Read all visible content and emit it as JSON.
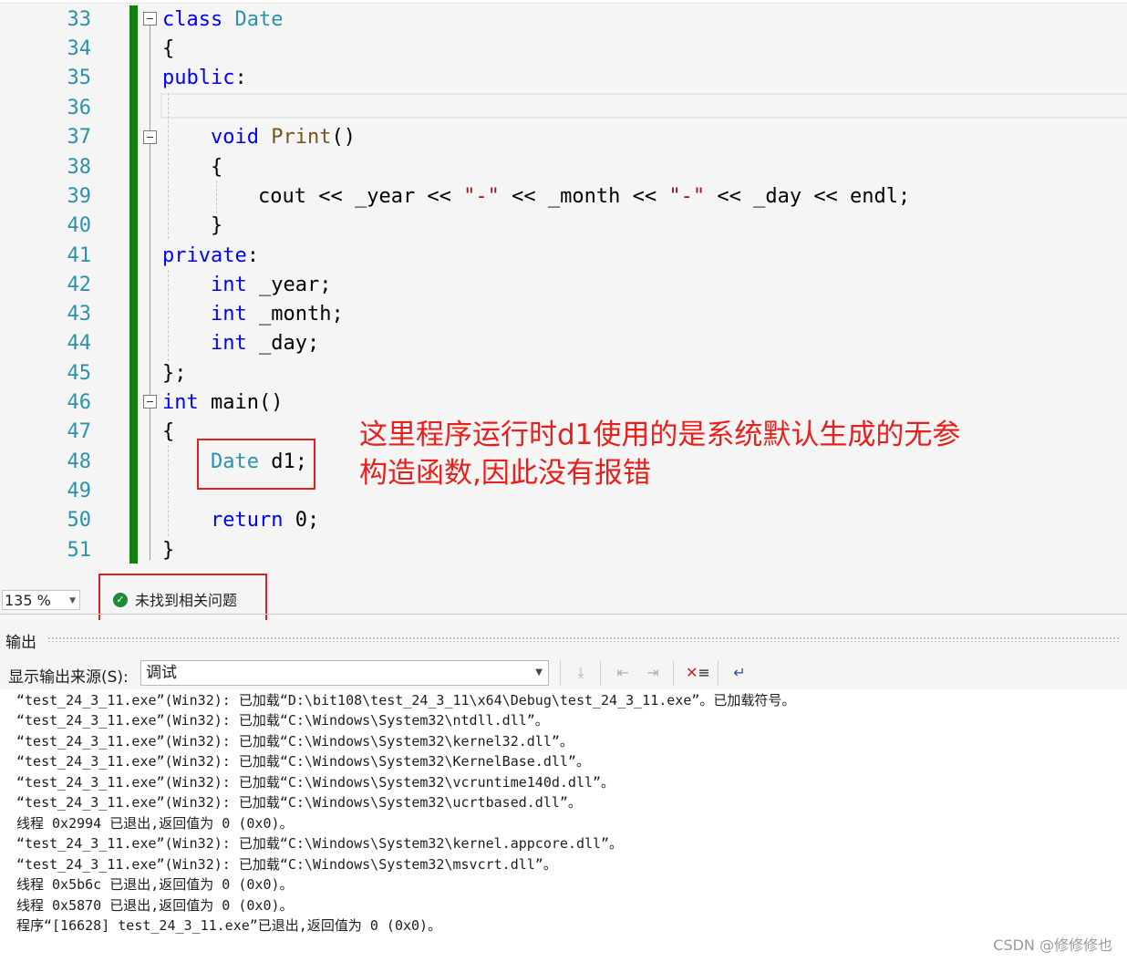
{
  "editor": {
    "line_numbers": [
      "33",
      "34",
      "35",
      "36",
      "37",
      "38",
      "39",
      "40",
      "41",
      "42",
      "43",
      "44",
      "45",
      "46",
      "47",
      "48",
      "49",
      "50",
      "51"
    ],
    "code": {
      "l33_kw": "class",
      "l33_name": " Date",
      "l34": "{",
      "l35_kw": "public",
      "l35_rest": ":",
      "l37_kw": "void",
      "l37_fn": " Print",
      "l37_rest": "()",
      "l38": "{",
      "l39_a": "cout << _year << ",
      "l39_s1": "\"-\"",
      "l39_b": " << _month << ",
      "l39_s2": "\"-\"",
      "l39_c": " << _day << endl;",
      "l40": "}",
      "l41_kw": "private",
      "l41_rest": ":",
      "l42_kw": "int",
      "l42_rest": " _year;",
      "l43_kw": "int",
      "l43_rest": " _month;",
      "l44_kw": "int",
      "l44_rest": " _day;",
      "l45": "};",
      "l46_kw": "int",
      "l46_rest": " main()",
      "l47": "{",
      "l48_ty": "Date",
      "l48_rest": " d1;",
      "l50_kw": "return",
      "l50_rest": " 0;",
      "l51": "}"
    },
    "annotation_line1": "这里程序运行时d1使用的是系统默认生成的无参",
    "annotation_line2": "构造函数,因此没有报错"
  },
  "status": {
    "zoom": "135 %",
    "issues_text": "未找到相关问题"
  },
  "output_panel": {
    "title": "输出",
    "source_label": "显示输出来源(S):",
    "source_value": "调试",
    "lines": [
      "“test_24_3_11.exe”(Win32): 已加载“D:\\bit108\\test_24_3_11\\x64\\Debug\\test_24_3_11.exe”。已加载符号。",
      "“test_24_3_11.exe”(Win32): 已加载“C:\\Windows\\System32\\ntdll.dll”。",
      "“test_24_3_11.exe”(Win32): 已加载“C:\\Windows\\System32\\kernel32.dll”。",
      "“test_24_3_11.exe”(Win32): 已加载“C:\\Windows\\System32\\KernelBase.dll”。",
      "“test_24_3_11.exe”(Win32): 已加载“C:\\Windows\\System32\\vcruntime140d.dll”。",
      "“test_24_3_11.exe”(Win32): 已加载“C:\\Windows\\System32\\ucrtbased.dll”。",
      "线程 0x2994 已退出,返回值为 0 (0x0)。",
      "“test_24_3_11.exe”(Win32): 已加载“C:\\Windows\\System32\\kernel.appcore.dll”。",
      "“test_24_3_11.exe”(Win32): 已加载“C:\\Windows\\System32\\msvcrt.dll”。",
      "线程 0x5b6c 已退出,返回值为 0 (0x0)。",
      "线程 0x5870 已退出,返回值为 0 (0x0)。",
      "程序“[16628] test_24_3_11.exe”已退出,返回值为 0 (0x0)。"
    ]
  },
  "watermark": "CSDN @修修修也",
  "colors": {
    "keyword": "#0000ff",
    "type": "#2b91af",
    "string": "#a31515",
    "annotation": "#e8201c",
    "change_bar": "#108010"
  }
}
